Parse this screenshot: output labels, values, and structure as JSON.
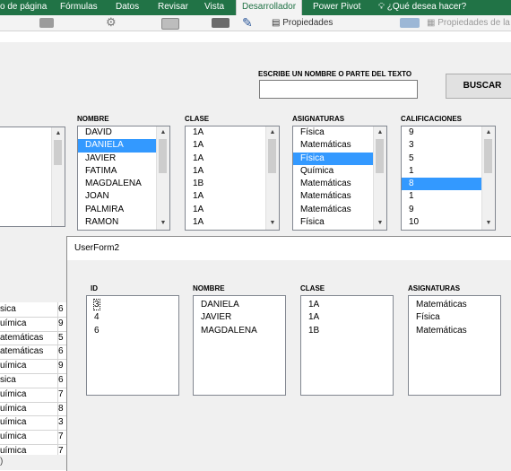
{
  "ribbon": {
    "tabs": [
      {
        "label": "o de página",
        "active": false
      },
      {
        "label": "Fórmulas",
        "active": false
      },
      {
        "label": "Datos",
        "active": false
      },
      {
        "label": "Revisar",
        "active": false
      },
      {
        "label": "Vista",
        "active": false
      },
      {
        "label": "Desarrollador",
        "active": true
      },
      {
        "label": "Power Pivot",
        "active": false
      }
    ],
    "tell_me": "¿Qué desea hacer?",
    "tools": {
      "properties_label": "Propiedades",
      "properties2_label": "Propiedades de la a"
    }
  },
  "search": {
    "caption": "ESCRIBE UN NOMBRE O PARTE DEL TEXTO",
    "value": "",
    "button_label": "BUSCAR"
  },
  "main_lists": {
    "nombre": {
      "caption": "NOMBRE",
      "items": [
        "DAVID",
        "DANIELA",
        "JAVIER",
        "FATIMA",
        "MAGDALENA",
        "JOAN",
        "PALMIRA",
        "RAMON"
      ],
      "selected": 1
    },
    "clase": {
      "caption": "CLASE",
      "items": [
        "1A",
        "1A",
        "1A",
        "1A",
        "1B",
        "1A",
        "1A",
        "1A"
      ]
    },
    "asignaturas": {
      "caption": "ASIGNATURAS",
      "items": [
        "Física",
        "Matemáticas",
        "Física",
        "Química",
        "Matemáticas",
        "Matemáticas",
        "Matemáticas",
        "Física"
      ],
      "selected": 2
    },
    "calificaciones": {
      "caption": "CALIFICACIONES",
      "items": [
        "9",
        "3",
        "5",
        "1",
        "8",
        "1",
        "9",
        "10"
      ],
      "selected": 4
    }
  },
  "sheet_rows": [
    {
      "text": "sica",
      "num": "6"
    },
    {
      "text": "uímica",
      "num": "9"
    },
    {
      "text": "atemáticas",
      "num": "5"
    },
    {
      "text": "atemáticas",
      "num": "6"
    },
    {
      "text": "uímica",
      "num": "9"
    },
    {
      "text": "sica",
      "num": "6"
    },
    {
      "text": "uímica",
      "num": "7"
    },
    {
      "text": "uímica",
      "num": "8"
    },
    {
      "text": "uímica",
      "num": "3"
    },
    {
      "text": "uímica",
      "num": "7"
    },
    {
      "text": "uímica",
      "num": "7"
    }
  ],
  "status_text": ")",
  "userform": {
    "title": "UserForm2",
    "id": {
      "caption": "ID",
      "items": [
        "3",
        "4",
        "6"
      ]
    },
    "nombre": {
      "caption": "NOMBRE",
      "items": [
        "DANIELA",
        "JAVIER",
        "MAGDALENA"
      ]
    },
    "clase": {
      "caption": "CLASE",
      "items": [
        "1A",
        "1A",
        "1B"
      ]
    },
    "asignaturas": {
      "caption": "ASIGNATURAS",
      "items": [
        "Matemáticas",
        "Física",
        "Matemáticas"
      ]
    }
  },
  "colors": {
    "ribbon_green": "#217346",
    "selection_blue": "#3399ff",
    "form_gray": "#f0f0f0"
  }
}
